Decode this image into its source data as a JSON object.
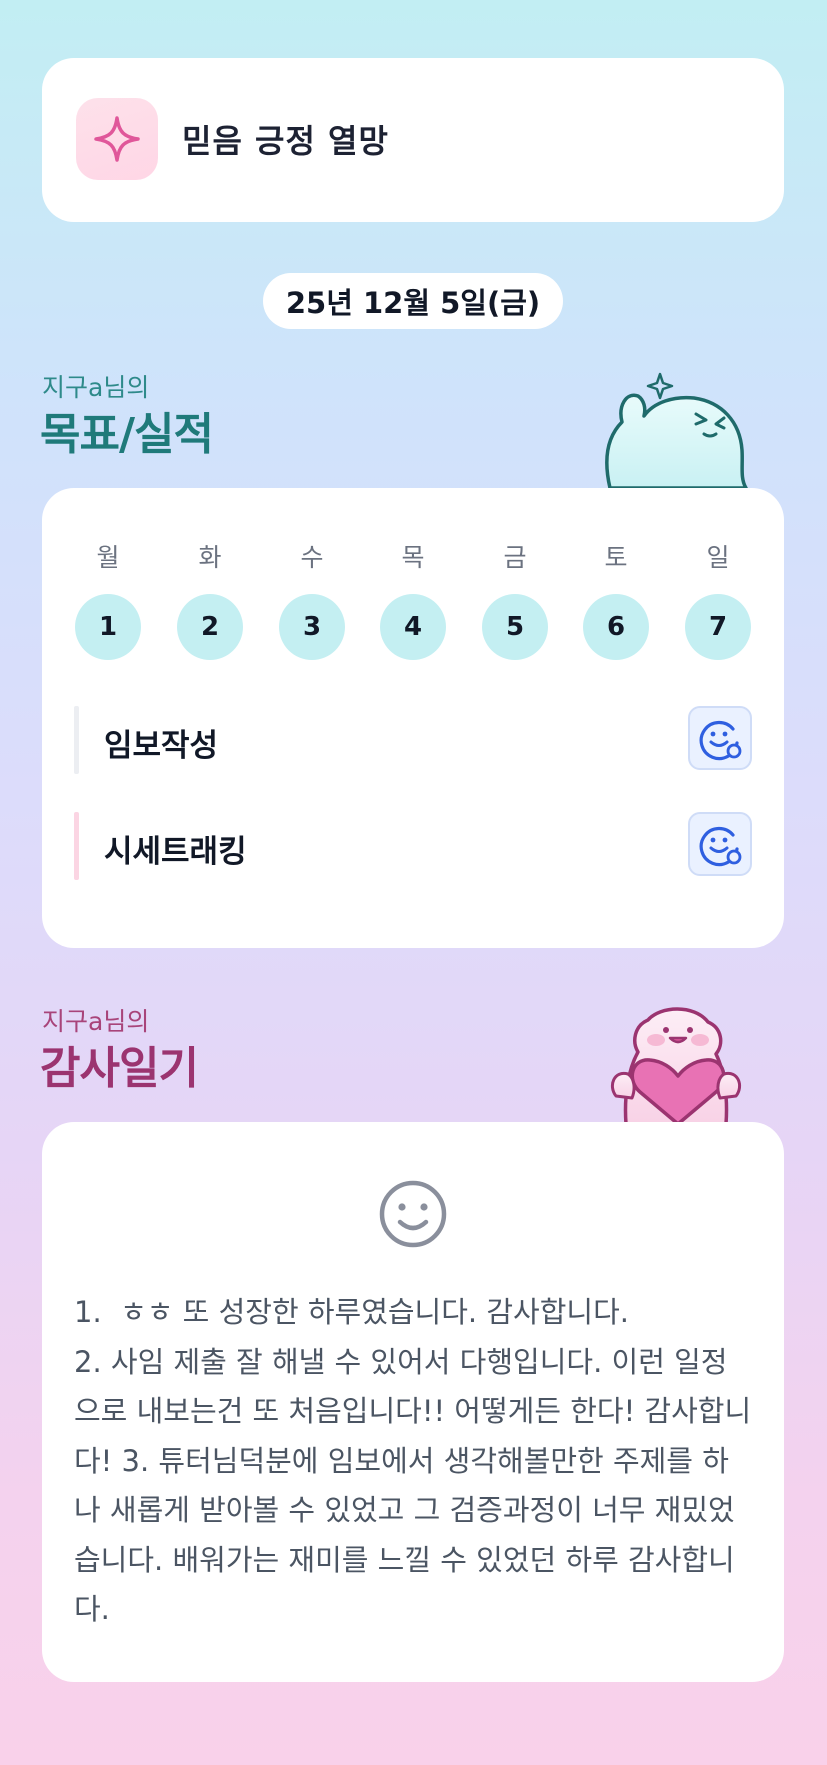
{
  "header": {
    "title": "믿음 긍정 열망",
    "icon": "sparkle-icon"
  },
  "date": "25년 12월 5일(금)",
  "goals": {
    "subtitle": "지구a님의",
    "title": "목표/실적",
    "week": [
      {
        "day": "월",
        "num": "1"
      },
      {
        "day": "화",
        "num": "2"
      },
      {
        "day": "수",
        "num": "3"
      },
      {
        "day": "목",
        "num": "4"
      },
      {
        "day": "금",
        "num": "5"
      },
      {
        "day": "토",
        "num": "6"
      },
      {
        "day": "일",
        "num": "7"
      }
    ],
    "tasks": [
      {
        "label": "임보작성",
        "bar_color": "#eceef2",
        "icon": "mood-add-icon"
      },
      {
        "label": "시세트래킹",
        "bar_color": "#fbd5e3",
        "icon": "mood-add-icon"
      }
    ]
  },
  "gratitude": {
    "subtitle": "지구a님의",
    "title": "감사일기",
    "icon": "smile-icon",
    "text": "1.  ㅎㅎ 또 성장한 하루였습니다. 감사합니다.\n2. 사임 제출 잘 해낼 수 있어서 다행입니다. 이런 일정으로 내보는건 또 처음입니다!! 어떻게든 한다! 감사합니다! 3. 튜터님덕분에 임보에서 생각해볼만한 주제를 하나 새롭게 받아볼 수 있었고 그 검증과정이 너무 재밌었습니다. 배워가는 재미를 느낄 수 있었던 하루 감사합니다."
  },
  "colors": {
    "goal_accent": "#1f7a7a",
    "gratitude_accent": "#9b3470",
    "day_circle": "#c4eff2",
    "button_icon": "#2f5fe0"
  }
}
